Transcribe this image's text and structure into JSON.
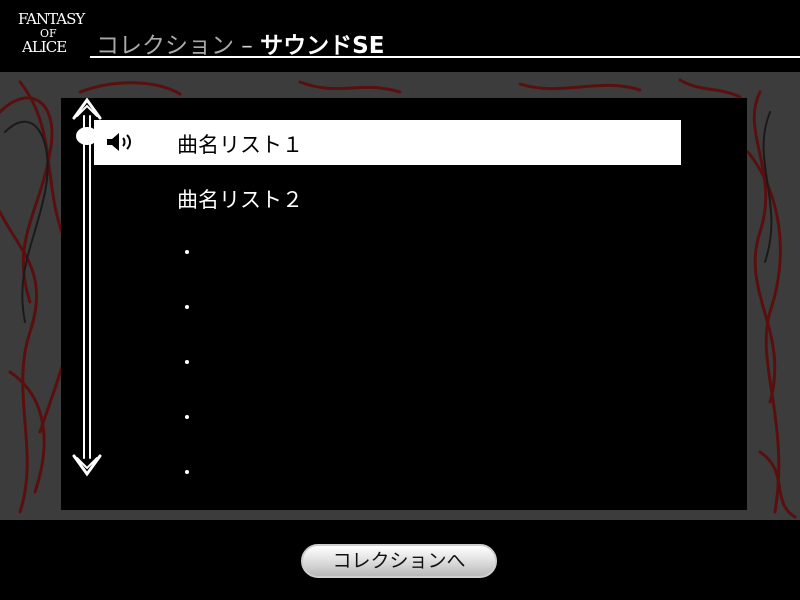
{
  "header": {
    "logo_line1": "FANTASY",
    "logo_line2": "OF",
    "logo_line3": "ALICE",
    "title": "コレクション",
    "separator": " – ",
    "subtitle": "サウンドSE"
  },
  "list": {
    "items": [
      {
        "label": "曲名リスト１",
        "selected": true
      },
      {
        "label": "曲名リスト２",
        "selected": false
      },
      {
        "label": "",
        "placeholder": "・"
      },
      {
        "label": "",
        "placeholder": "・"
      },
      {
        "label": "",
        "placeholder": "・"
      },
      {
        "label": "",
        "placeholder": "・"
      },
      {
        "label": "",
        "placeholder": "・"
      }
    ],
    "playing_icon": "speaker-playing-icon"
  },
  "scroll": {
    "position": 0
  },
  "footer": {
    "back_label": "コレクションへ"
  },
  "colors": {
    "background": "#000000",
    "backdrop": "#3c3c3c",
    "scribble": "#5a0f0f",
    "selection": "#ffffff",
    "title_dim": "#a9a9a9"
  }
}
